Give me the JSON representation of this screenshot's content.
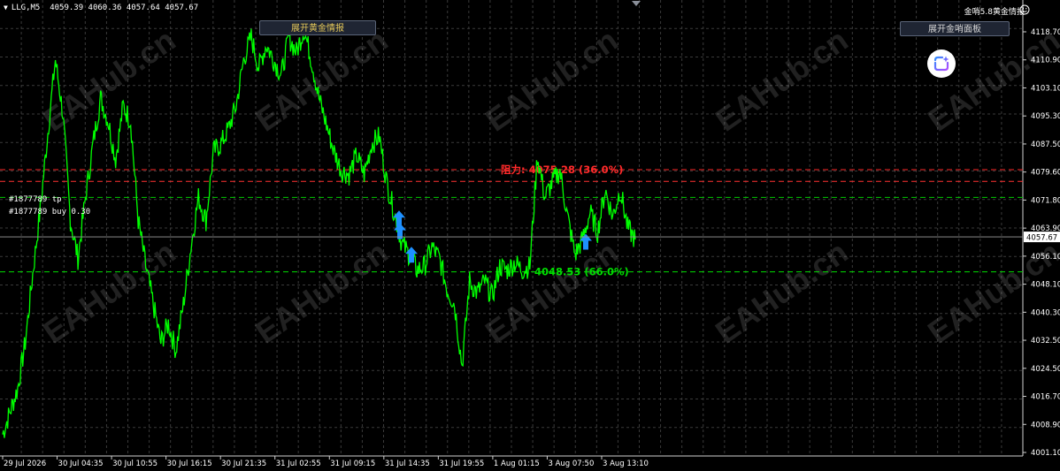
{
  "header": {
    "symbol": "LLG,M5",
    "ohlc": "4059.39 4060.36 4057.64 4057.67",
    "indicator_label": "金哨5.8黄金情报"
  },
  "buttons": {
    "expand_gold_info": "展开黄金情报",
    "expand_panel": "展开金哨面板"
  },
  "orders": [
    {
      "label": "#1877789 tp"
    },
    {
      "label": "#1877789 buy 0.30"
    }
  ],
  "watermark": "EAHub.cn",
  "colors": {
    "background": "#000000",
    "grid": "#3a3a3a",
    "price_line": "#00ff00",
    "resistance": "#ff2a2a",
    "support": "#00dd00",
    "arrow": "#1e90ff",
    "axis_text": "#ffffff"
  },
  "chart_data": {
    "type": "line",
    "title": "",
    "y_ticks": [
      "4118.70",
      "4110.90",
      "4103.10",
      "4095.30",
      "4087.50",
      "4079.60",
      "4071.80",
      "4063.90",
      "4056.10",
      "4048.10",
      "4040.30",
      "4032.50",
      "4024.50",
      "4016.70",
      "4008.90",
      "4001.10"
    ],
    "ylim": [
      4000.3,
      4119.7
    ],
    "x_ticks": [
      "29 Jul 2026",
      "30 Jul 04:35",
      "30 Jul 10:55",
      "30 Jul 16:15",
      "30 Jul 21:35",
      "31 Jul 02:55",
      "31 Jul 09:15",
      "31 Jul 14:35",
      "31 Jul 19:55",
      "1 Aug 01:15",
      "3 Aug 07:50",
      "3 Aug 13:10"
    ],
    "current_price": "4057.67",
    "current_price_value": 4057.67,
    "levels": [
      {
        "name": "resistance",
        "price": 4075.28,
        "label": "阻力: 4075.28 (36.0%)",
        "color": "#ff2a2a"
      },
      {
        "name": "support",
        "price": 4048.53,
        "label": "4048.53 (66.0%)",
        "color": "#00dd00"
      },
      {
        "name": "tp",
        "price": 4072.2,
        "color": "#ff3333"
      },
      {
        "name": "buy",
        "price": 4068.0,
        "color": "#00cc00"
      }
    ],
    "buy_arrows": [
      {
        "x": "31 Jul 13:00",
        "y": 4062.5
      },
      {
        "x": "31 Jul 13:20",
        "y": 4059.2
      },
      {
        "x": "31 Jul 14:00",
        "y": 4053.0
      },
      {
        "x": "3 Aug 08:10",
        "y": 4056.4
      }
    ],
    "series": [
      {
        "x_range": [
          "29 Jul 2026",
          "3 Aug 14:45"
        ],
        "values": [
          4006,
          4012,
          4018,
          4030,
          4048,
          4065,
          4085,
          4104,
          4090,
          4062,
          4052,
          4068,
          4082,
          4094,
          4088,
          4078,
          4092,
          4088,
          4062,
          4050,
          4040,
          4030,
          4035,
          4028,
          4040,
          4055,
          4068,
          4062,
          4080,
          4082,
          4086,
          4092,
          4104,
          4110,
          4102,
          4108,
          4104,
          4100,
          4110,
          4106,
          4112,
          4104,
          4094,
          4087,
          4080,
          4075,
          4074,
          4079,
          4074,
          4082,
          4084,
          4072,
          4064,
          4056,
          4053,
          4049,
          4050,
          4055,
          4052,
          4044,
          4040,
          4024,
          4046,
          4043,
          4046,
          4042,
          4050,
          4049,
          4051,
          4049,
          4050,
          4079,
          4068,
          4072,
          4075,
          4063,
          4053,
          4057,
          4064,
          4059,
          4070,
          4063,
          4070,
          4060,
          4057
        ]
      }
    ]
  }
}
